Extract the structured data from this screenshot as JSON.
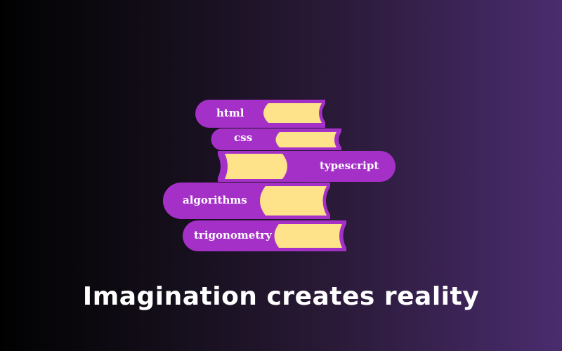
{
  "books": [
    {
      "label": "html"
    },
    {
      "label": "css"
    },
    {
      "label": "typescript"
    },
    {
      "label": "algorithms"
    },
    {
      "label": "trigonometry"
    }
  ],
  "tagline": "Imagination creates reality",
  "colors": {
    "book_cover": "#a530c8",
    "pages": "#ffe38a",
    "text": "#ffffff"
  }
}
